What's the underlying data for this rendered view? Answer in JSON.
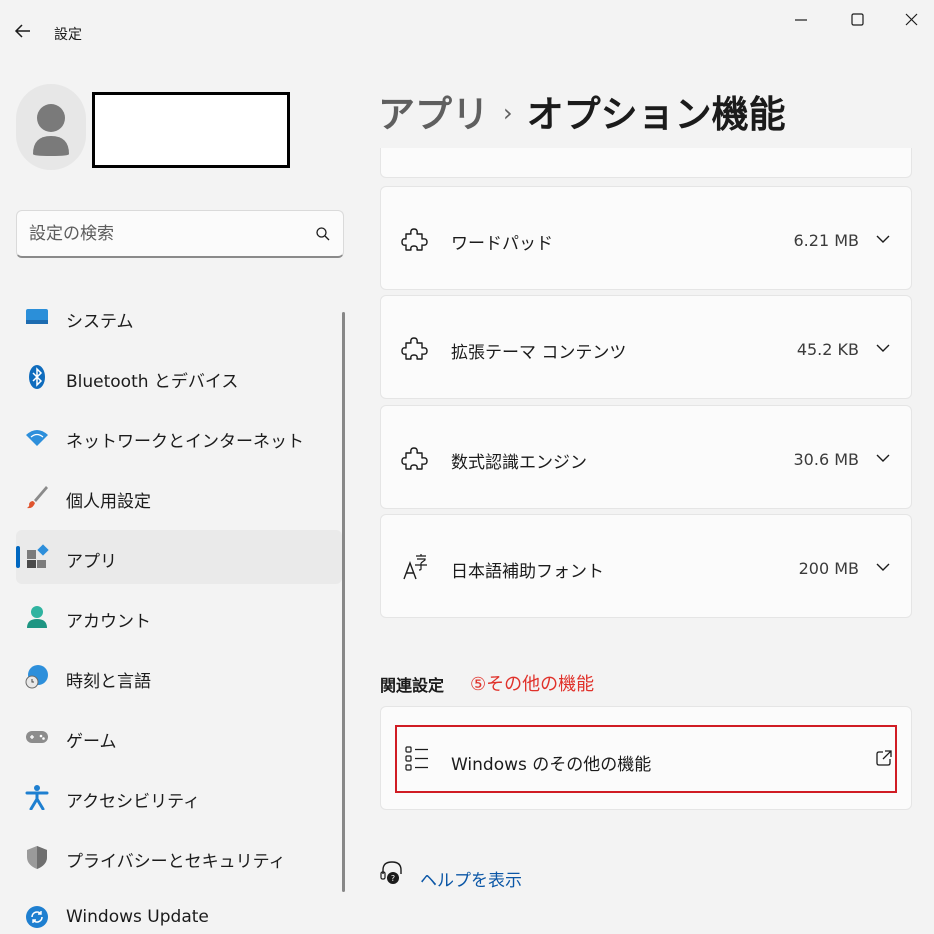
{
  "window": {
    "title": "設定",
    "controls": {
      "minimize": "minimize-icon",
      "maximize": "maximize-icon",
      "close": "close-icon"
    }
  },
  "search": {
    "placeholder": "設定の検索",
    "value": ""
  },
  "sidebar": {
    "selected_index": 4,
    "items": [
      {
        "label": "システム",
        "icon": "system-icon"
      },
      {
        "label": "Bluetooth とデバイス",
        "icon": "bluetooth-icon"
      },
      {
        "label": "ネットワークとインターネット",
        "icon": "wifi-icon"
      },
      {
        "label": "個人用設定",
        "icon": "paintbrush-icon"
      },
      {
        "label": "アプリ",
        "icon": "apps-icon"
      },
      {
        "label": "アカウント",
        "icon": "account-icon"
      },
      {
        "label": "時刻と言語",
        "icon": "globe-clock-icon"
      },
      {
        "label": "ゲーム",
        "icon": "gamepad-icon"
      },
      {
        "label": "アクセシビリティ",
        "icon": "accessibility-icon"
      },
      {
        "label": "プライバシーとセキュリティ",
        "icon": "shield-icon"
      },
      {
        "label": "Windows Update",
        "icon": "update-icon"
      }
    ]
  },
  "breadcrumb": {
    "parent": "アプリ",
    "separator": "›",
    "current": "オプション機能"
  },
  "features": [
    {
      "name": "ワードパッド",
      "size": "6.21 MB",
      "icon": "puzzle-icon"
    },
    {
      "name": "拡張テーマ コンテンツ",
      "size": "45.2 KB",
      "icon": "puzzle-icon"
    },
    {
      "name": "数式認識エンジン",
      "size": "30.6 MB",
      "icon": "puzzle-icon"
    },
    {
      "name": "日本語補助フォント",
      "size": "200 MB",
      "icon": "font-icon"
    }
  ],
  "related": {
    "heading": "関連設定",
    "annotation": "⑤その他の機能",
    "link_label": "Windows のその他の機能"
  },
  "help": {
    "label": "ヘルプを表示"
  },
  "colors": {
    "accent": "#0067c0",
    "annotation": "#e0312a",
    "highlight_border": "#d01c24",
    "link": "#0a56a6"
  }
}
